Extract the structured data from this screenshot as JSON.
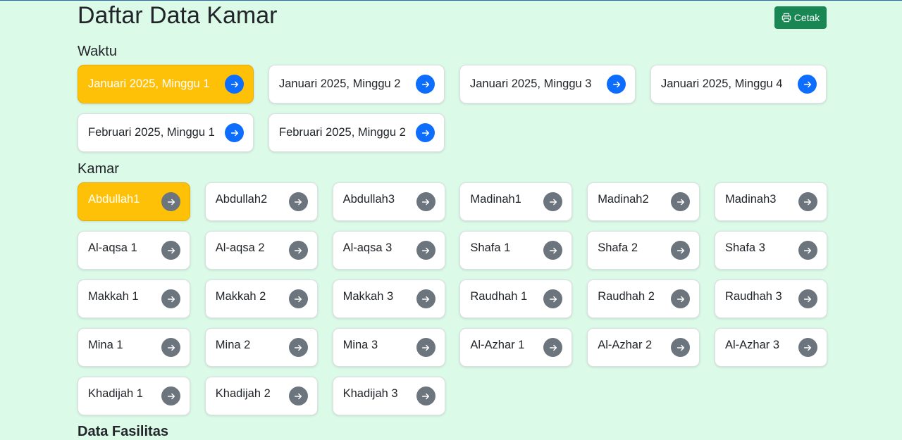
{
  "page": {
    "title": "Daftar Data Kamar",
    "print_label": "Cetak"
  },
  "waktu": {
    "title": "Waktu",
    "items": [
      {
        "label": "Januari 2025, Minggu 1",
        "active": true
      },
      {
        "label": "Januari 2025, Minggu 2",
        "active": false
      },
      {
        "label": "Januari 2025, Minggu 3",
        "active": false
      },
      {
        "label": "Januari 2025, Minggu 4",
        "active": false
      },
      {
        "label": "Februari 2025, Minggu 1",
        "active": false
      },
      {
        "label": "Februari 2025, Minggu 2",
        "active": false
      }
    ]
  },
  "kamar": {
    "title": "Kamar",
    "items": [
      {
        "label": "Abdullah1",
        "active": true
      },
      {
        "label": "Abdullah2",
        "active": false
      },
      {
        "label": "Abdullah3",
        "active": false
      },
      {
        "label": "Madinah1",
        "active": false
      },
      {
        "label": "Madinah2",
        "active": false
      },
      {
        "label": "Madinah3",
        "active": false
      },
      {
        "label": "Al-aqsa 1",
        "active": false
      },
      {
        "label": "Al-aqsa 2",
        "active": false
      },
      {
        "label": "Al-aqsa 3",
        "active": false
      },
      {
        "label": "Shafa 1",
        "active": false
      },
      {
        "label": "Shafa 2",
        "active": false
      },
      {
        "label": "Shafa 3",
        "active": false
      },
      {
        "label": "Makkah 1",
        "active": false
      },
      {
        "label": "Makkah 2",
        "active": false
      },
      {
        "label": "Makkah 3",
        "active": false
      },
      {
        "label": "Raudhah 1",
        "active": false
      },
      {
        "label": "Raudhah 2",
        "active": false
      },
      {
        "label": "Raudhah 3",
        "active": false
      },
      {
        "label": "Mina 1",
        "active": false
      },
      {
        "label": "Mina 2",
        "active": false
      },
      {
        "label": "Mina 3",
        "active": false
      },
      {
        "label": "Al-Azhar 1",
        "active": false
      },
      {
        "label": "Al-Azhar 2",
        "active": false
      },
      {
        "label": "Al-Azhar 3",
        "active": false
      },
      {
        "label": "Khadijah 1",
        "active": false
      },
      {
        "label": "Khadijah 2",
        "active": false
      },
      {
        "label": "Khadijah 3",
        "active": false
      }
    ]
  },
  "fasilitas": {
    "title": "Data Fasilitas"
  },
  "icons": {
    "print": "printer-icon",
    "waktu_arrow": "arrow-right-icon",
    "kamar_arrow": "arrow-right-icon"
  },
  "colors": {
    "background": "#dcfae8",
    "active": "#ffc107",
    "print_button": "#198754",
    "arrow_primary": "#0d6efd",
    "arrow_secondary": "#6c757d"
  }
}
